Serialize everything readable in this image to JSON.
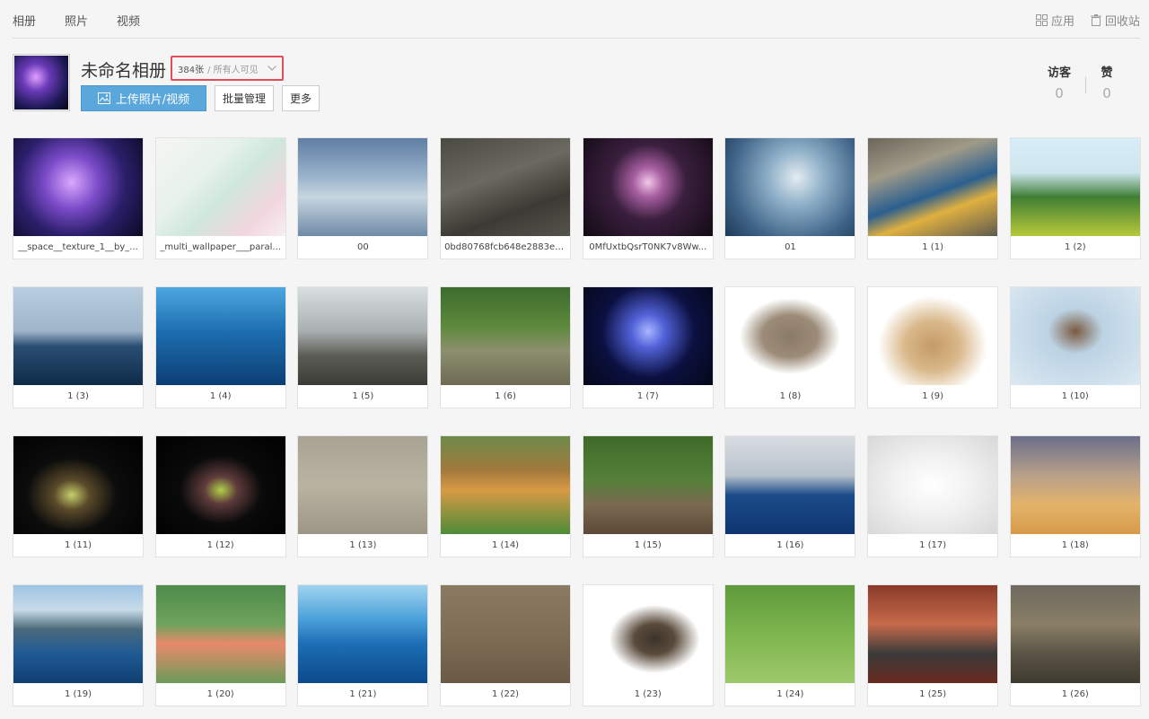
{
  "nav": {
    "tabs": [
      "相册",
      "照片",
      "视频"
    ],
    "apps_label": "应用",
    "trash_label": "回收站"
  },
  "album": {
    "title": "未命名相册",
    "count": "384张",
    "visibility": "/ 所有人可见",
    "upload_label": "上传照片/视频",
    "batch_label": "批量管理",
    "more_label": "更多"
  },
  "stats": {
    "visitors_label": "访客",
    "visitors": "0",
    "likes_label": "赞",
    "likes": "0"
  },
  "photos": [
    {
      "name": "__space__texture_1__by_...",
      "bg": "radial-gradient(circle at 45% 45%,#d9a8ff 0,#7b4bc9 30%,#2b1f6b 60%,#0a0a22 100%)"
    },
    {
      "name": "_multi_wallpaper___paral...",
      "bg": "linear-gradient(135deg,#f6f6f4 0%,#e8f2ec 35%,#cfe8dc 55%,#f1d6de 80%,#f7eef0 100%)"
    },
    {
      "name": "00",
      "bg": "linear-gradient(180deg,#5f7ea3 0%,#9bb4cc 40%,#c7d6e0 60%,#6e8aa6 100%)"
    },
    {
      "name": "0bd80768fcb648e2883e4...",
      "bg": "linear-gradient(160deg,#4a4a44 0%,#6b6a60 40%,#3b3a34 70%,#55544c 100%)"
    },
    {
      "name": "0MfUxtbQsrT0NK7v8Ww...",
      "bg": "radial-gradient(circle at 50% 45%,#f2c8e8 0,#a65ea0 18%,#3a1f3e 45%,#120a14 100%)"
    },
    {
      "name": "01",
      "bg": "radial-gradient(circle at 55% 40%,#e4ecf2 0,#8fb0c8 30%,#3f6488 70%,#1f3956 100%)"
    },
    {
      "name": "1 (1)",
      "bg": "linear-gradient(160deg,#6b665a 0%,#a09a88 30%,#2b5f8f 55%,#e0b040 70%,#5e5a50 100%)"
    },
    {
      "name": "1 (2)",
      "bg": "linear-gradient(180deg,#d7eef8 0%,#cfe6ef 35%,#3f7e34 60%,#b7c93a 100%)"
    },
    {
      "name": "1 (3)",
      "bg": "linear-gradient(180deg,#b9cde0 0%,#9fb4c9 45%,#2a4f74 60%,#0e2a48 100%)"
    },
    {
      "name": "1 (4)",
      "bg": "linear-gradient(180deg,#4ea7e0 0%,#1d6eb0 45%,#0b3e74 100%)"
    },
    {
      "name": "1 (5)",
      "bg": "linear-gradient(180deg,#d9dedf 0%,#a9afb0 45%,#5b5d55 70%,#3a3b36 100%)"
    },
    {
      "name": "1 (6)",
      "bg": "linear-gradient(180deg,#3c6b2e 0%,#5d8a3c 40%,#8d8f6e 65%,#6e6a55 100%)"
    },
    {
      "name": "1 (7)",
      "bg": "radial-gradient(circle at 50% 45%,#a9b6ff 0,#5162d8 20%,#0b1040 55%,#050818 100%)"
    },
    {
      "name": "1 (8)",
      "bg": "radial-gradient(ellipse at 50% 50%,#8a7a68 0,#9b8b77 30%,#ffffff 55%,#ffffff 100%)"
    },
    {
      "name": "1 (9)",
      "bg": "radial-gradient(ellipse at 50% 60%,#c49a66 0,#d9b88a 30%,#ffffff 60%,#ffffff 100%)"
    },
    {
      "name": "1 (10)",
      "bg": "radial-gradient(ellipse at 50% 45%,#7a5a40 0,#bcd3e4 30%,#dce9f2 100%)"
    },
    {
      "name": "1 (11)",
      "bg": "radial-gradient(ellipse at 45% 60%,#c9ce6a 0,#5a4a2a 18%,#0c0c0c 45%,#000000 100%)"
    },
    {
      "name": "1 (12)",
      "bg": "radial-gradient(ellipse at 50% 55%,#b2d04a 0,#5f3c3c 18%,#0a0a0a 45%,#000000 100%)"
    },
    {
      "name": "1 (13)",
      "bg": "linear-gradient(180deg,#a8a394 0%,#b9b3a2 50%,#9d9686 100%)"
    },
    {
      "name": "1 (14)",
      "bg": "linear-gradient(180deg,#6d8a4a 0%,#a27a3c 35%,#d89a45 55%,#4d8b38 100%)"
    },
    {
      "name": "1 (15)",
      "bg": "linear-gradient(180deg,#3f6b2a 0%,#55803a 45%,#7a6a52 70%,#5a4a36 100%)"
    },
    {
      "name": "1 (16)",
      "bg": "linear-gradient(180deg,#d9dde2 0%,#b8c2cc 40%,#1c4c8a 60%,#0d3570 100%)"
    },
    {
      "name": "1 (17)",
      "bg": "radial-gradient(ellipse at 50% 50%,#ffffff 0,#f2f2f2 40%,#d8d8d8 100%)"
    },
    {
      "name": "1 (18)",
      "bg": "linear-gradient(180deg,#6b6e8a 0%,#b8a08a 40%,#e3b36a 70%,#d79a48 100%)"
    },
    {
      "name": "1 (19)",
      "bg": "linear-gradient(180deg,#9ec4e4 0%,#c7dbe9 25%,#4a6a7a 45%,#1f5a96 70%,#0f3e70 100%)"
    },
    {
      "name": "1 (20)",
      "bg": "linear-gradient(180deg,#4e8a4a 0%,#6ea35c 40%,#e88a6a 60%,#6a9a5a 100%)"
    },
    {
      "name": "1 (21)",
      "bg": "linear-gradient(180deg,#9fd4f0 0%,#4aa0d8 35%,#1c6eb5 60%,#0c4a8a 100%)"
    },
    {
      "name": "1 (22)",
      "bg": "linear-gradient(180deg,#8a7a62 0%,#7e6e56 50%,#6a5a44 100%)"
    },
    {
      "name": "1 (23)",
      "bg": "radial-gradient(ellipse at 55% 55%,#3c332a 0,#5a4b3c 20%,#ffffff 45%,#ffffff 100%)"
    },
    {
      "name": "1 (24)",
      "bg": "linear-gradient(180deg,#5e9a3c 0%,#7db54e 50%,#9ec96a 100%)"
    },
    {
      "name": "1 (25)",
      "bg": "linear-gradient(180deg,#8a3a2a 0%,#c76a4a 40%,#3a3a3a 70%,#6a2a20 100%)"
    },
    {
      "name": "1 (26)",
      "bg": "linear-gradient(180deg,#6e6a5e 0%,#8a7e66 40%,#5a5446 70%,#3f3a30 100%)"
    }
  ]
}
